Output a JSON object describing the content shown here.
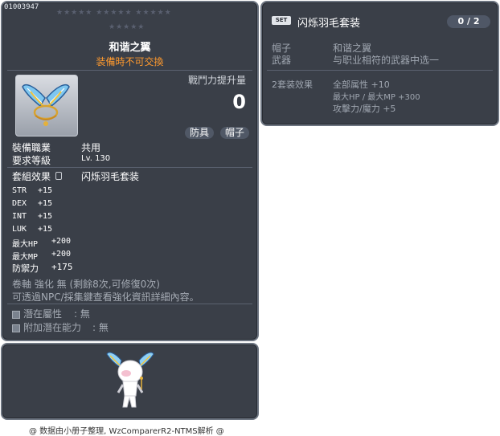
{
  "item": {
    "id": "01003947",
    "stars_row1": "★★★★★   ★★★★★   ★★★★★",
    "stars_row2": "★★★★★",
    "name": "和谐之翼",
    "trade_note": "装備時不可交換",
    "power_label": "戰鬥力提升量",
    "power_value": "0",
    "tag_category": "防具",
    "tag_type": "帽子",
    "job_label": "裝備職業",
    "job_value": "共用",
    "level_label": "要求等級",
    "level_value": "Lv. 130",
    "set_label": "套組效果",
    "set_name": "闪烁羽毛套装",
    "stats": [
      {
        "label": "STR",
        "value": "+15"
      },
      {
        "label": "DEX",
        "value": "+15"
      },
      {
        "label": "INT",
        "value": "+15"
      },
      {
        "label": "LUK",
        "value": "+15"
      },
      {
        "label": "最大HP",
        "value": "+200"
      },
      {
        "label": "最大MP",
        "value": "+200"
      },
      {
        "label": "防禦力",
        "value": "+175"
      }
    ],
    "scroll_info": "卷軸 強化 無 (剩餘8次,可修復0次)",
    "npc_info": "可透過NPC/採集鍵查看強化資訊詳細內容。",
    "potential_label": "潛在屬性",
    "potential_value": ": 無",
    "bonus_potential_label": "附加潛在能力",
    "bonus_potential_value": ": 無"
  },
  "set": {
    "badge": "SET",
    "name": "闪烁羽毛套装",
    "count": "0 / 2",
    "parts": [
      {
        "slot": "帽子",
        "name": "和谐之翼"
      },
      {
        "slot": "武器",
        "name": "与职业相符的武器中选一"
      }
    ],
    "bonus_label": "2套装效果",
    "bonus_lines": [
      "全部属性 +10",
      "最大HP / 最大MP  +300",
      "攻擊力/魔力 +5"
    ]
  },
  "credit": "@ 数据由小册子整理, WzComparerR2-NTMS解析 @",
  "colors": {
    "panel_bg": "#3a3f48",
    "panel_border": "#6c7480",
    "trade_note": "#ff9a2e",
    "muted_text": "#9fa6b0"
  }
}
